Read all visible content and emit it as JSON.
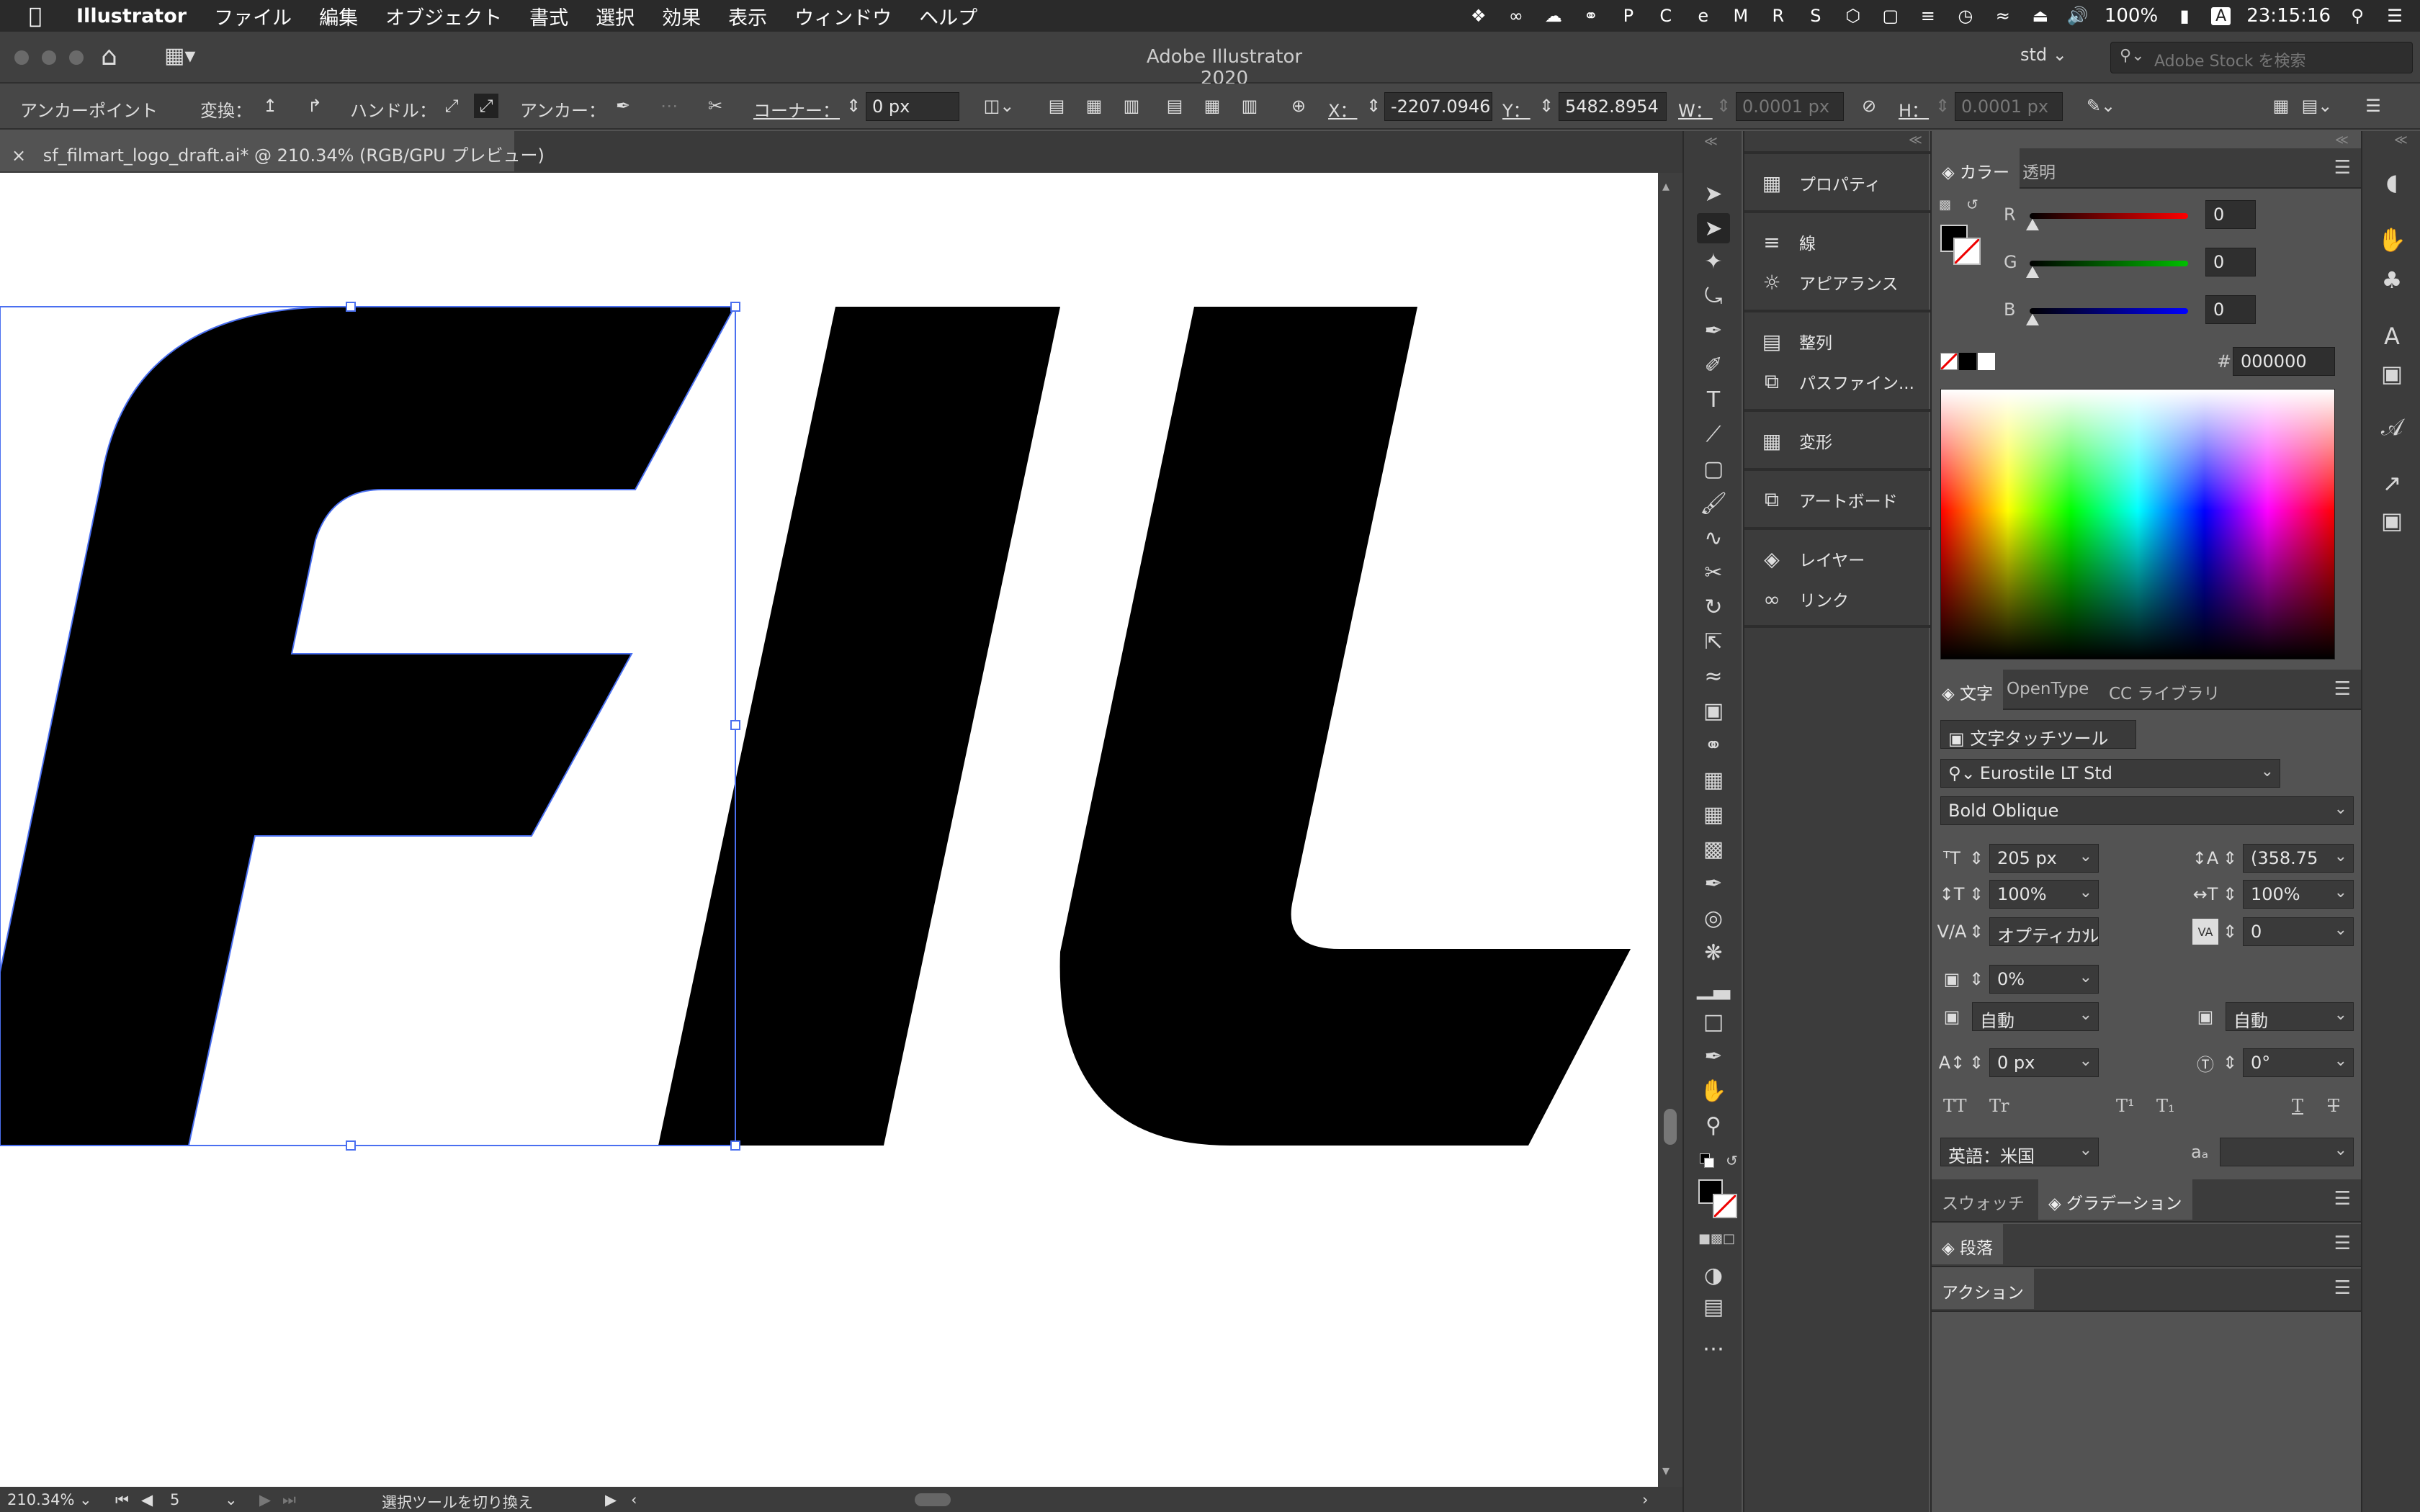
{
  "menubar": {
    "app_name": "Illustrator",
    "items": [
      "ファイル",
      "編集",
      "オブジェクト",
      "書式",
      "選択",
      "効果",
      "表示",
      "ウィンドウ",
      "ヘルプ"
    ],
    "battery": "100%",
    "clock": "23:15:16",
    "input_method": "A"
  },
  "appbar": {
    "title": "Adobe Illustrator 2020",
    "workspace": "std",
    "stock_placeholder": "Adobe Stock を検索"
  },
  "control": {
    "anchor_point_label": "アンカーポイント",
    "convert_label": "変換：",
    "handle_label": "ハンドル：",
    "anchor_label": "アンカー：",
    "corner_label": "コーナー：",
    "corner_value": "0 px",
    "x_label": "X：",
    "x_value": "-2207.0946",
    "y_label": "Y：",
    "y_value": "5482.8954",
    "w_label": "W：",
    "w_value": "0.0001 px",
    "h_label": "H：",
    "h_value": "0.0001 px"
  },
  "document": {
    "tab_title": "sf_filmart_logo_draft.ai* @ 210.34% (RGB/GPU プレビュー)",
    "artwork_letters": "FIL"
  },
  "status": {
    "zoom": "210.34%",
    "artboard_number": "5",
    "tool_hint": "選択ツールを切り換え"
  },
  "panel_list": [
    {
      "label": "プロパティ",
      "icon": "properties-icon"
    },
    {
      "label": "線",
      "icon": "stroke-icon"
    },
    {
      "label": "アピアランス",
      "icon": "appearance-icon"
    },
    {
      "label": "整列",
      "icon": "align-icon"
    },
    {
      "label": "パスファイン...",
      "icon": "pathfinder-icon"
    },
    {
      "label": "変形",
      "icon": "transform-icon"
    },
    {
      "label": "アートボード",
      "icon": "artboards-icon"
    },
    {
      "label": "レイヤー",
      "icon": "layers-icon"
    },
    {
      "label": "リンク",
      "icon": "links-icon"
    }
  ],
  "color_panel": {
    "tabs": [
      "カラー",
      "透明"
    ],
    "r_label": "R",
    "r": "0",
    "g_label": "G",
    "g": "0",
    "b_label": "B",
    "b": "0",
    "hex_label": "#",
    "hex": "000000",
    "colors": {
      "fill": "#000000",
      "r_track": "#ff0000",
      "g_track": "#00c000",
      "b_track": "#0000ff"
    }
  },
  "char_panel": {
    "tabs": [
      "文字",
      "OpenType",
      "CC ライブラリ"
    ],
    "touch_type_label": "文字タッチツール",
    "font_family": "Eurostile LT Std",
    "font_style": "Bold Oblique",
    "font_size": "205 px",
    "leading": "(358.75",
    "vertical_scale": "100%",
    "horizontal_scale": "100%",
    "kerning": "オプティカル",
    "tracking": "0",
    "tsume": "0%",
    "aki_left": "自動",
    "aki_right": "自動",
    "baseline_shift": "0 px",
    "rotation": "0°",
    "tt_label": "TT",
    "tr_label": "Tr",
    "super_label": "T¹",
    "sub_label": "T₁",
    "underline_label": "T",
    "strike_label": "T",
    "language": "英語：米国",
    "aa_label": "aₐ",
    "aa_value": ""
  },
  "bottom_panels": {
    "swatch_tab": "スウォッチ",
    "gradient_tab": "グラデーション",
    "paragraph_tab": "段落",
    "actions_tab": "アクション"
  }
}
